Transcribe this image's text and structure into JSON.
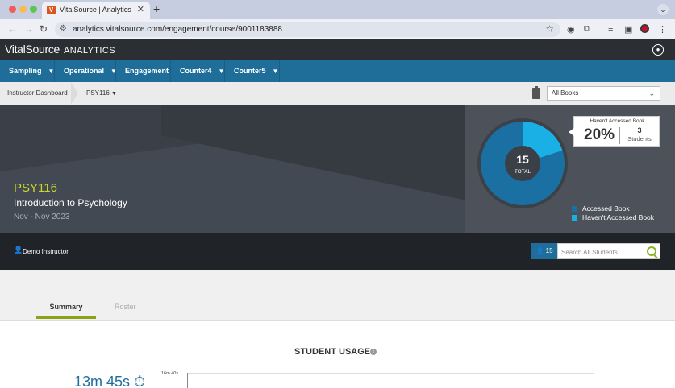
{
  "browser": {
    "tab_title": "VitalSource | Analytics",
    "tab_favicon_letter": "V",
    "url": "analytics.vitalsource.com/engagement/course/9001183888",
    "icons": [
      "back-arrow-icon",
      "forward-arrow-icon",
      "reload-icon",
      "site-settings-icon",
      "star-icon",
      "extension-icon",
      "puzzle-icon",
      "reading-list-icon",
      "side-panel-icon",
      "profile-icon",
      "kebab-menu-icon"
    ],
    "colors": {
      "close": "#ee5f57",
      "minimize": "#f5bd4f",
      "maximize": "#5fc454"
    }
  },
  "app": {
    "brand": "VitalSource",
    "brand_sub": "ANALYTICS",
    "nav": [
      {
        "label": "Sampling"
      },
      {
        "label": "Operational"
      },
      {
        "label": "Engagement"
      },
      {
        "label": "Counter4"
      },
      {
        "label": "Counter5"
      }
    ],
    "breadcrumb": {
      "root": "Instructor Dashboard",
      "course": "PSY116"
    },
    "book_select": "All Books",
    "course": {
      "code": "PSY116",
      "title": "Introduction to Psychology",
      "dates": "Nov - Nov 2023"
    },
    "donut": {
      "total": "15",
      "total_label": "TOTAL",
      "tooltip_label": "Haven't Accessed Book",
      "tooltip_pct": "20%",
      "tooltip_count": "3",
      "tooltip_unit": "Students",
      "legend": [
        {
          "label": "Accessed Book",
          "color": "#1a6fa3"
        },
        {
          "label": "Haven't Accessed Book",
          "color": "#1ab0e6"
        }
      ]
    },
    "instructor": "Demo Instructor",
    "student_count": "15",
    "search_placeholder": "Search All Students",
    "tabs": {
      "summary": "Summary",
      "roster": "Roster"
    },
    "usage_title": "STUDENT USAGE",
    "usage_time": "13m 45s",
    "axis_top_label": "16m 40s"
  },
  "chart_data": {
    "type": "pie",
    "categories": [
      "Accessed Book",
      "Haven't Accessed Book"
    ],
    "values": [
      12,
      3
    ],
    "colors": [
      "#1a6fa3",
      "#1ab0e6"
    ],
    "center_text": "15 TOTAL"
  }
}
